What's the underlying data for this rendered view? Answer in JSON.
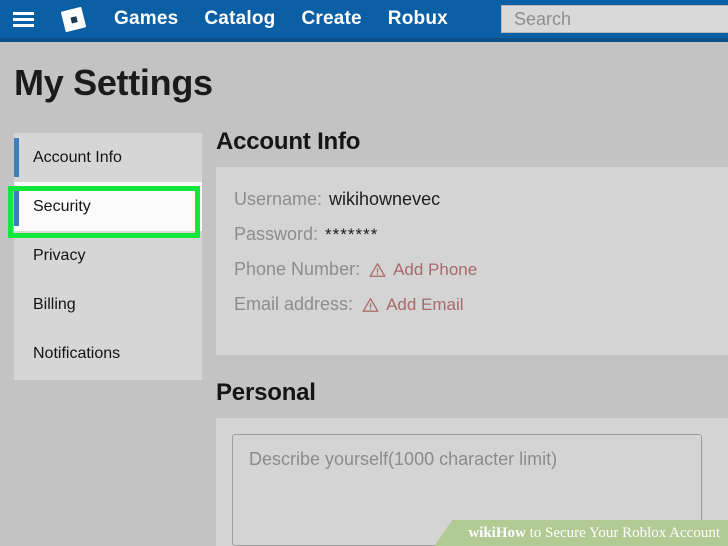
{
  "topnav": {
    "menu_icon": "hamburger-menu-icon",
    "logo_icon": "roblox-logo-icon",
    "links": [
      {
        "label": "Games"
      },
      {
        "label": "Catalog"
      },
      {
        "label": "Create"
      },
      {
        "label": "Robux"
      }
    ],
    "search": {
      "placeholder": "Search",
      "value": ""
    },
    "background_color": "#0b5fa5"
  },
  "page": {
    "title": "My Settings",
    "background_color": "#c3c3c3"
  },
  "sidebar": {
    "items": [
      {
        "label": "Account Info",
        "active": false
      },
      {
        "label": "Security",
        "active": true
      },
      {
        "label": "Privacy",
        "active": false
      },
      {
        "label": "Billing",
        "active": false
      },
      {
        "label": "Notifications",
        "active": false
      }
    ],
    "highlight": {
      "target_label": "Security",
      "color": "#13e63d"
    }
  },
  "main": {
    "account_info": {
      "heading": "Account Info",
      "rows": [
        {
          "label": "Username:",
          "value": "wikihownevec",
          "type": "text"
        },
        {
          "label": "Password:",
          "value": "*******",
          "type": "mask"
        },
        {
          "label": "Phone Number:",
          "action": "Add Phone",
          "icon": "warning-triangle-icon",
          "type": "action"
        },
        {
          "label": "Email address:",
          "action": "Add Email",
          "icon": "warning-triangle-icon",
          "type": "action"
        }
      ],
      "action_color": "#a96a6a"
    },
    "personal": {
      "heading": "Personal",
      "describe_placeholder": "Describe yourself(1000 character limit)",
      "describe_value": ""
    }
  },
  "watermark": {
    "brand": "wikiHow",
    "suffix": " to Secure Your Roblox Account",
    "background_color": "#b2ca94"
  }
}
